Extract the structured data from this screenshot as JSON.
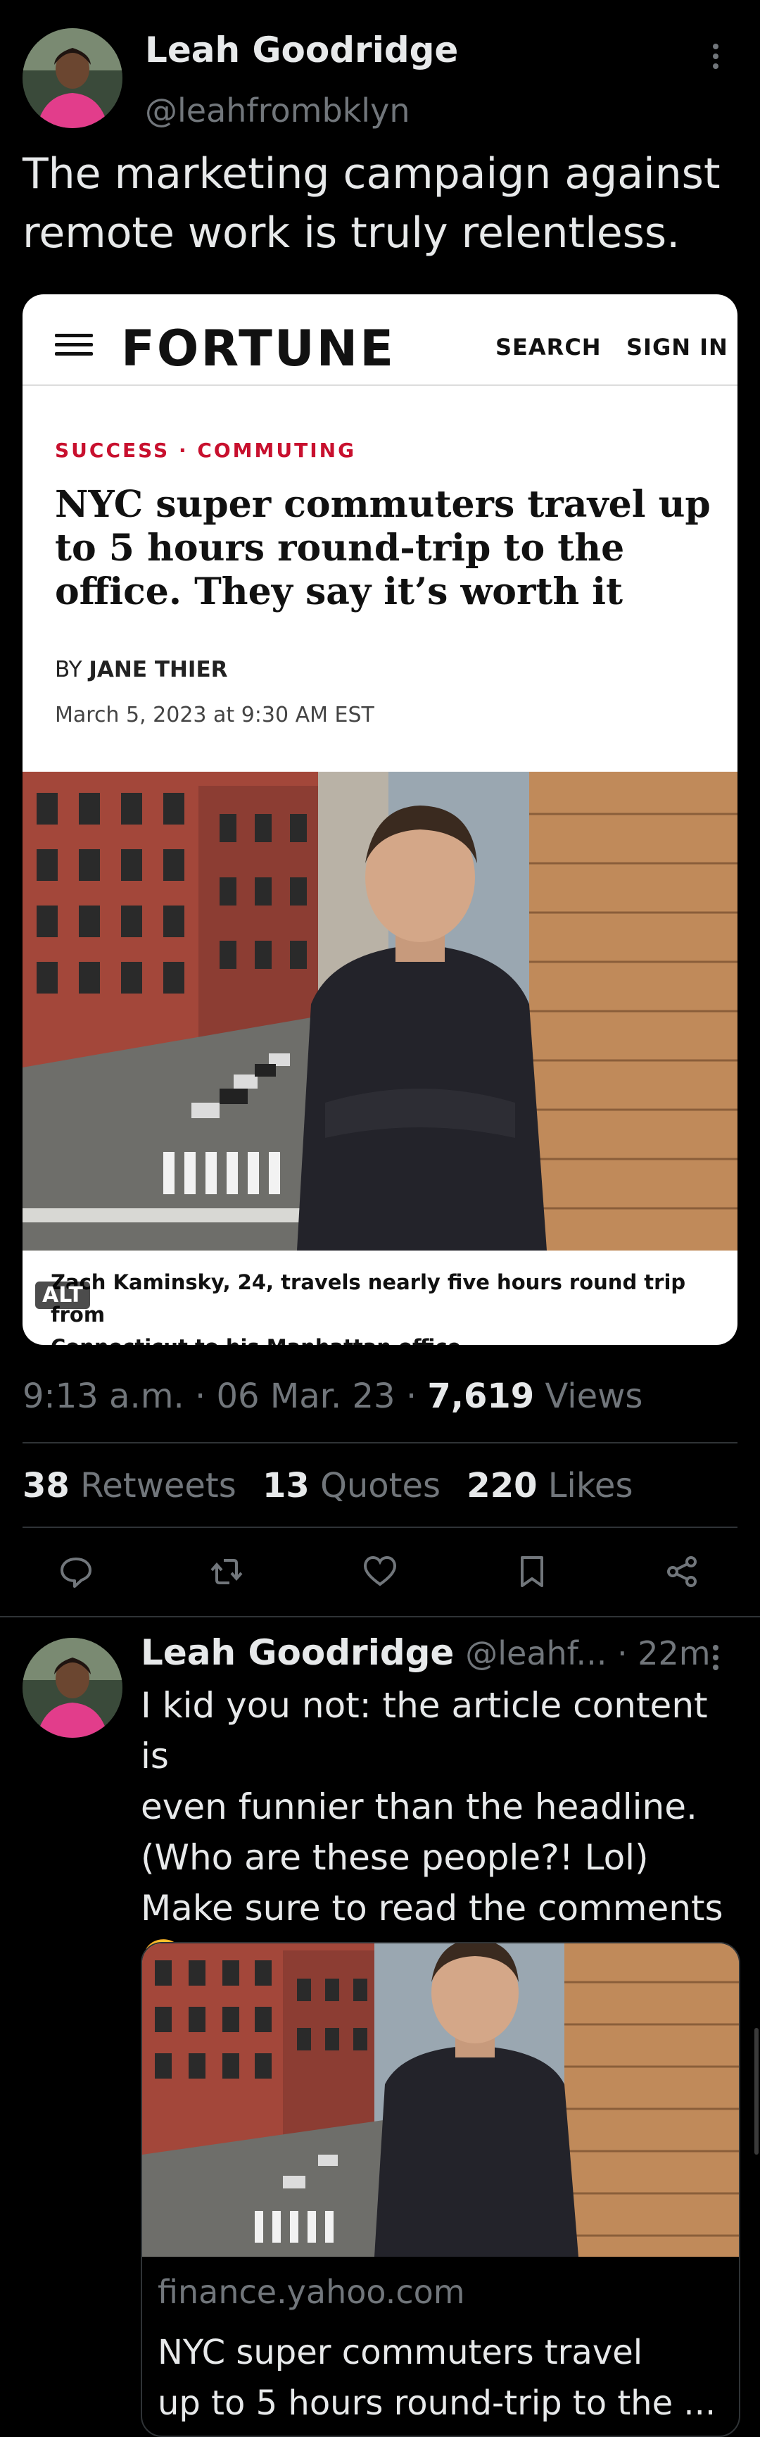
{
  "main_tweet": {
    "author_name": "Leah Goodridge",
    "author_handle": "@leahfrombklyn",
    "text_line1": "The marketing campaign against",
    "text_line2": "remote work is truly relentless.",
    "embedded": {
      "logo": "FORTUNE",
      "search_label": "SEARCH",
      "signin_label": "SIGN IN",
      "category": "SUCCESS · COMMUTING",
      "headline_line1": "NYC super commuters travel up",
      "headline_line2": "to 5 hours round-trip to the",
      "headline_line3": "office. They say it’s worth it",
      "by_label": "BY",
      "author": "JANE THIER",
      "date": "March 5, 2023 at 9:30 AM EST",
      "caption_line1": "Zach Kaminsky, 24, travels nearly five hours round trip from",
      "caption_line2": "Connecticut to his Manhattan office.",
      "alt_badge": "ALT"
    },
    "meta_time": "9:13 a.m. · 06 Mar. 23 · ",
    "views_count": "7,619",
    "views_label": " Views",
    "retweets_count": "38",
    "retweets_label": "Retweets",
    "quotes_count": "13",
    "quotes_label": "Quotes",
    "likes_count": "220",
    "likes_label": "Likes"
  },
  "reply_tweet": {
    "author_name": "Leah Goodridge",
    "author_handle_time": "@leahf... · 22m",
    "line1": "I kid you not: the article content is",
    "line2": "even funnier than the headline.",
    "line3": "(Who are these people?! Lol)",
    "line4": "Make sure to read the comments",
    "emoji": "🤭",
    "link_domain": "finance.yahoo.com",
    "link_title1": "NYC super commuters travel",
    "link_title2": "up to 5 hours round-trip to the ..."
  },
  "colors": {
    "background": "#000000",
    "text": "#e7e9ea",
    "muted": "#71767b",
    "fortune_category_red": "#c8102e",
    "divider": "#2f3336"
  }
}
